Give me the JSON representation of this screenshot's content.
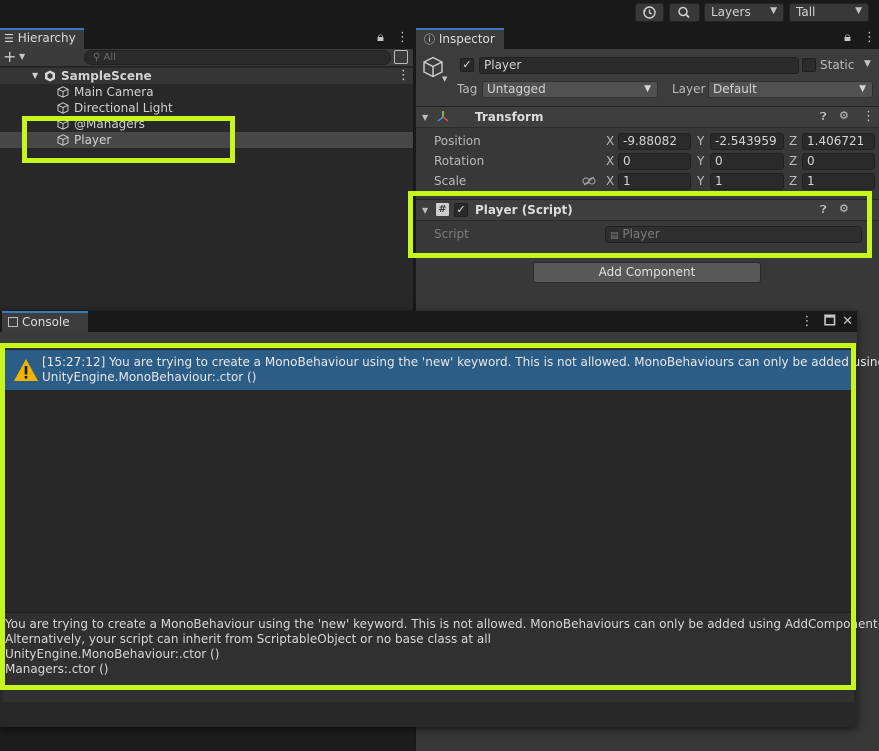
{
  "toolbar": {
    "history_icon": "history-icon",
    "search_icon": "search-icon",
    "layers_label": "Layers",
    "layout_label": "Tall"
  },
  "hierarchy": {
    "tab_label": "Hierarchy",
    "search_placeholder": "All",
    "scene_name": "SampleScene",
    "items": [
      {
        "label": "Main Camera"
      },
      {
        "label": "Directional Light"
      },
      {
        "label": "@Managers"
      },
      {
        "label": "Player"
      }
    ]
  },
  "inspector": {
    "tab_label": "Inspector",
    "object_name": "Player",
    "static_label": "Static",
    "tag_label": "Tag",
    "tag_value": "Untagged",
    "layer_label": "Layer",
    "layer_value": "Default",
    "transform": {
      "title": "Transform",
      "position_label": "Position",
      "rotation_label": "Rotation",
      "scale_label": "Scale",
      "position": {
        "x": "-9.88082",
        "y": "-2.543959",
        "z": "1.406721"
      },
      "rotation": {
        "x": "0",
        "y": "0",
        "z": "0"
      },
      "scale": {
        "x": "1",
        "y": "1",
        "z": "1"
      },
      "axis_x": "X",
      "axis_y": "Y",
      "axis_z": "Z"
    },
    "script_component": {
      "title": "Player (Script)",
      "script_label": "Script",
      "script_value": "Player"
    },
    "add_component_label": "Add Component"
  },
  "console": {
    "tab_label": "Console",
    "log_entry": {
      "line1": "[15:27:12] You are trying to create a MonoBehaviour using the 'new' keyword.  This is not allowed.  MonoBehaviours can only be added using AddC",
      "line2": "UnityEngine.MonoBehaviour:.ctor ()"
    },
    "detail_lines": [
      "You are trying to create a MonoBehaviour using the 'new' keyword.  This is not allowed.  MonoBehaviours can only be added using AddComponent().",
      "Alternatively, your script can inherit from ScriptableObject or no base class at all",
      "UnityEngine.MonoBehaviour:.ctor ()",
      "Managers:.ctor ()"
    ]
  },
  "colors": {
    "highlight": "#c8f51c",
    "selection": "#2c5d87",
    "tab_accent": "#3a79bb",
    "warning": "#f0b400"
  }
}
